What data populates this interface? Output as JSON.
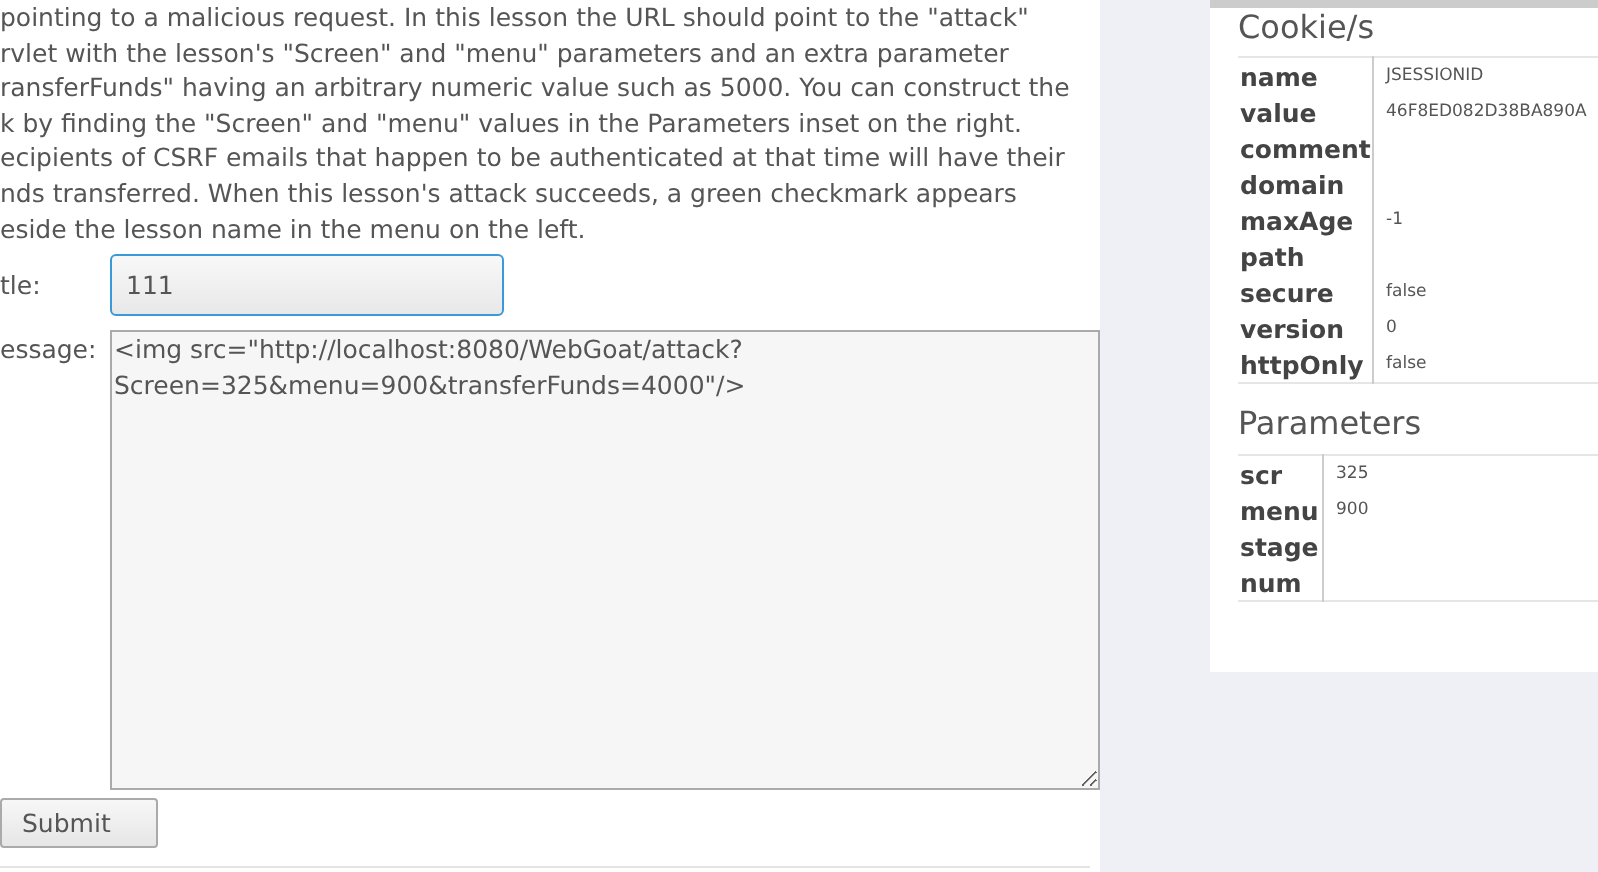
{
  "lesson_text": [
    "pointing to a malicious request. In this lesson the URL should point to the \"attack\"",
    "rvlet with the lesson's \"Screen\" and \"menu\" parameters and an extra parameter",
    "ransferFunds\" having an arbitrary numeric value such as 5000. You can construct the",
    "k by finding the \"Screen\" and \"menu\" values in the Parameters inset on the right.",
    "ecipients of CSRF emails that happen to be authenticated at that time will have their",
    "nds transferred. When this lesson's attack succeeds, a green checkmark appears",
    "eside the lesson name in the menu on the left."
  ],
  "form": {
    "title_label": "tle:",
    "title_value": "111",
    "message_label": "essage:",
    "message_value": "<img src=\"http://localhost:8080/WebGoat/attack?Screen=325&menu=900&transferFunds=4000\"/>",
    "submit": "Submit"
  },
  "cookies": {
    "heading": "Cookie/s",
    "rows": [
      {
        "name": "name",
        "value": "JSESSIONID"
      },
      {
        "name": "value",
        "value": "46F8ED082D38BA890A"
      },
      {
        "name": "comment",
        "value": ""
      },
      {
        "name": "domain",
        "value": ""
      },
      {
        "name": "maxAge",
        "value": "-1"
      },
      {
        "name": "path",
        "value": ""
      },
      {
        "name": "secure",
        "value": "false"
      },
      {
        "name": "version",
        "value": "0"
      },
      {
        "name": "httpOnly",
        "value": "false"
      }
    ]
  },
  "parameters": {
    "heading": "Parameters",
    "rows": [
      {
        "name": "scr",
        "value": "325"
      },
      {
        "name": "menu",
        "value": "900"
      },
      {
        "name": "stage",
        "value": ""
      },
      {
        "name": "num",
        "value": ""
      }
    ]
  }
}
